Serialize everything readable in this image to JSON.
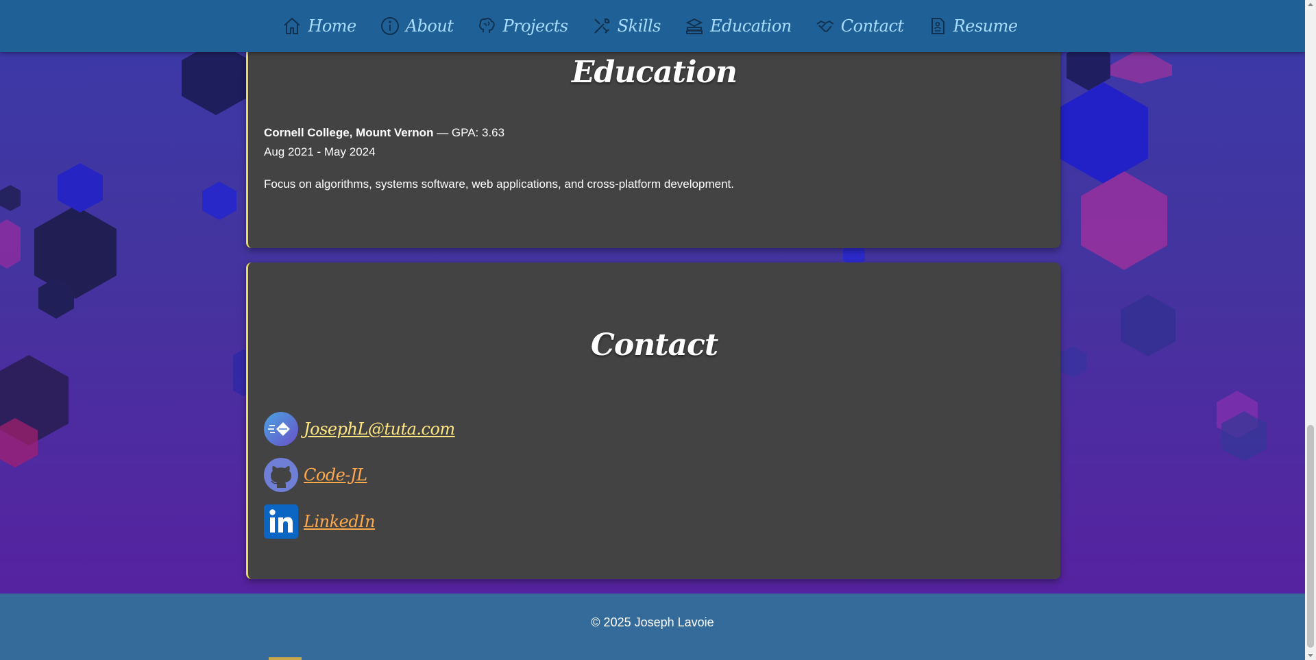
{
  "nav": {
    "items": [
      {
        "label": "Home",
        "icon": "home-icon"
      },
      {
        "label": "About",
        "icon": "info-icon"
      },
      {
        "label": "Projects",
        "icon": "brain-icon"
      },
      {
        "label": "Skills",
        "icon": "tools-icon"
      },
      {
        "label": "Education",
        "icon": "books-icon"
      },
      {
        "label": "Contact",
        "icon": "handshake-icon"
      },
      {
        "label": "Resume",
        "icon": "document-icon"
      }
    ]
  },
  "education": {
    "title": "Education",
    "school": "Cornell College, Mount Vernon",
    "gpa": " — GPA: 3.63",
    "dates": "Aug 2021 - May 2024",
    "description": "Focus on algorithms, systems software, web applications, and cross-platform development."
  },
  "contact": {
    "title": "Contact",
    "email": "JosephL@tuta.com",
    "github": "Code-JL",
    "linkedin": "LinkedIn"
  },
  "footer": {
    "copyright": "© 2025 Joseph Lavoie"
  },
  "colors": {
    "nav_bg": "#1f6196",
    "nav_text": "#a9dcff",
    "card_bg": "#434343",
    "card_accent": "#e8d85a",
    "email_link": "#ffe680",
    "other_link": "#ffa94d",
    "footer_bg": "#346b9a"
  }
}
